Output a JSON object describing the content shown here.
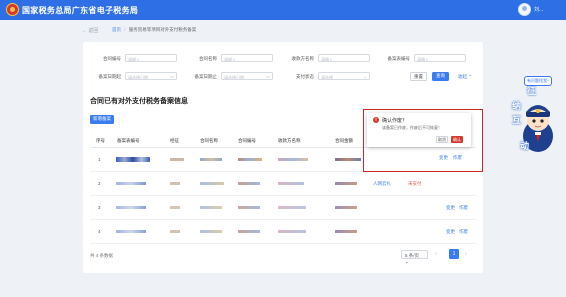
{
  "header": {
    "title": "国家税务总局广东省电子税务局",
    "user_name": "刘..."
  },
  "breadcrumb": {
    "back": "← 返回",
    "home": "首页",
    "separator": "/",
    "current": "服务贸易等项目对外支付税务备案"
  },
  "filters": [
    {
      "label": "合同编号",
      "placeholder": "请输入"
    },
    {
      "label": "合同名称",
      "placeholder": "请输入"
    },
    {
      "label": "收款方名称",
      "placeholder": "请输入"
    },
    {
      "label": "备案表编号",
      "placeholder": "请输入"
    },
    {
      "label": "备案日期起",
      "placeholder": "请选择日期"
    },
    {
      "label": "备案日期止",
      "placeholder": "请选择日期"
    },
    {
      "label": "支付状态",
      "placeholder": "请选择"
    }
  ],
  "buttons": {
    "reset": "重置",
    "query": "查询",
    "collapse": "收起 ⌃",
    "add": "新增备案"
  },
  "section_title": "合同已有对外支付税务备案信息",
  "table": {
    "headers": [
      "序号",
      "备案表编号",
      "经征",
      "合同名称",
      "合同编号",
      "收款方名称",
      "合同金额"
    ],
    "rows": [
      {
        "index": "1",
        "action_change": "变更",
        "action_void": "作废"
      },
      {
        "index": "2",
        "source": "人网云扎",
        "status": "未支付",
        "action_change": "变更",
        "action_void": "作废"
      },
      {
        "index": "3",
        "action_change": "变更",
        "action_void": "作废"
      },
      {
        "index": "4",
        "action_change": "变更",
        "action_void": "作废"
      }
    ]
  },
  "footer": {
    "total": "共 4 条数据",
    "page_size": "5 条/页 ⌄",
    "prev": "‹",
    "current_page": "1",
    "next": "›"
  },
  "popconfirm": {
    "title": "确认作废？",
    "message": "该备案已作废，作废后不可恢复！",
    "cancel": "取消",
    "confirm": "确认"
  },
  "mascot": {
    "bubble": "有问题找我~",
    "chars": [
      "征",
      "纳",
      "互",
      "动"
    ]
  },
  "colors": {
    "brand_blue": "#2e6fe6",
    "accent_blue": "#3b7bf0",
    "danger_red": "#d63a2f",
    "highlight": "#c8282a"
  }
}
